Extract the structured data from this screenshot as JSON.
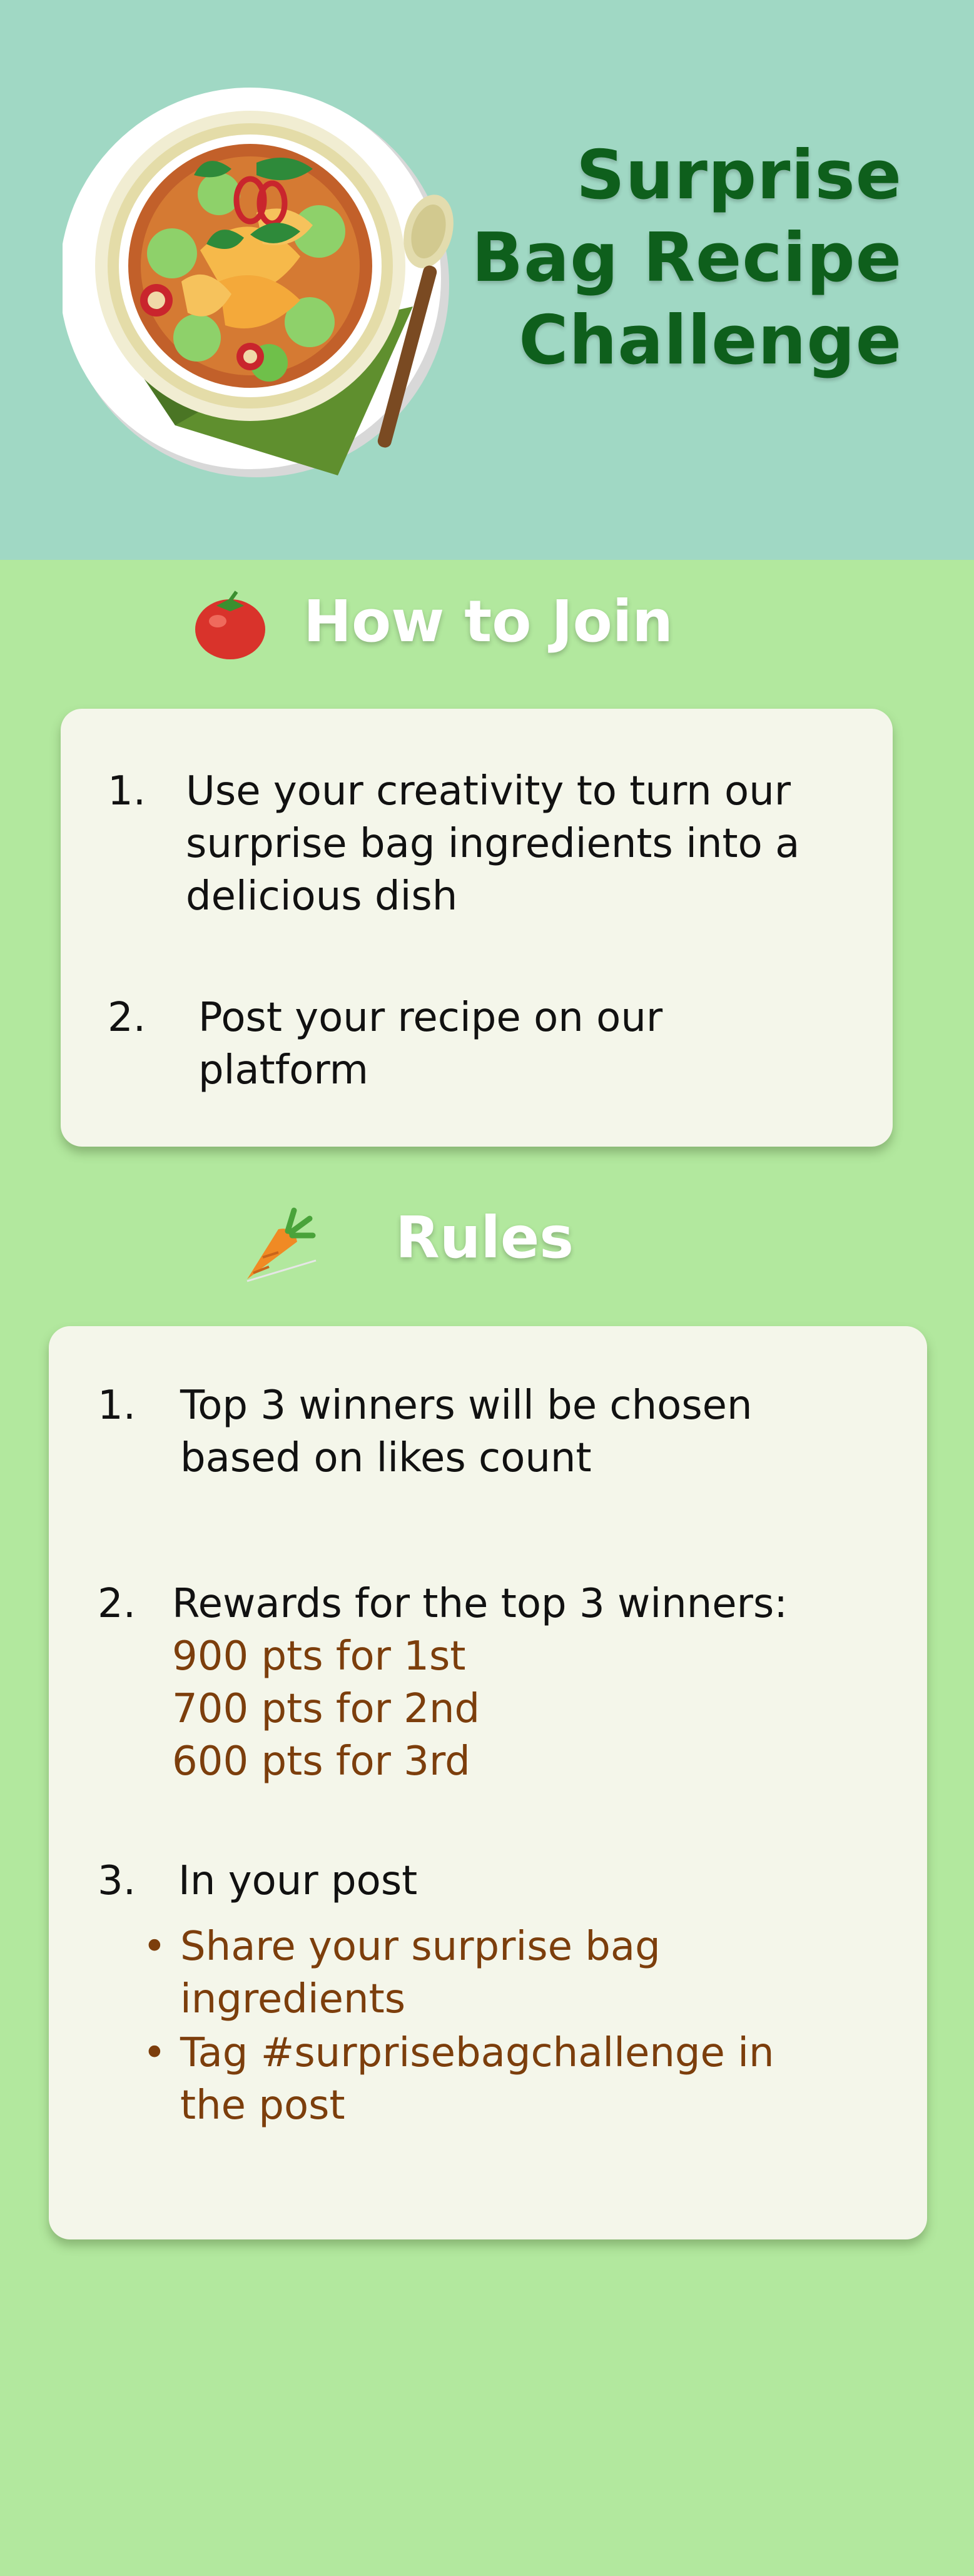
{
  "header": {
    "title_lines": [
      "Surprise",
      "Bag Recipe",
      "Challenge"
    ]
  },
  "how_to_join": {
    "heading": "How to Join",
    "icon": "tomato-icon",
    "steps": [
      {
        "number": "1.",
        "lines": [
          "Use your creativity to turn our",
          "surprise bag ingredients into a",
          "delicious dish"
        ]
      },
      {
        "number": "2.",
        "lines": [
          "Post your recipe on our",
          "platform"
        ]
      }
    ]
  },
  "rules": {
    "heading": "Rules",
    "icon": "carrot-icon",
    "items": [
      {
        "number": "1.",
        "lines": [
          "Top 3 winners will be chosen",
          "based on likes count"
        ]
      },
      {
        "number": "2.",
        "lead": "Rewards for the top 3 winners:",
        "rewards": [
          "900 pts for 1st",
          "700 pts for 2nd",
          "600 pts for 3rd"
        ]
      },
      {
        "number": "3.",
        "lead": "In your post",
        "bullets": [
          {
            "lines": [
              "Share your surprise bag",
              "ingredients"
            ]
          },
          {
            "lines": [
              "Tag #surprisebagchallenge in",
              "the post"
            ]
          }
        ]
      }
    ]
  },
  "colors": {
    "hero_bg": "#a0d8c4",
    "page_bg": "#b2e89e",
    "title": "#0e5f1c",
    "card_bg": "#f4f6ea",
    "accent_text": "#7c3e0c"
  }
}
